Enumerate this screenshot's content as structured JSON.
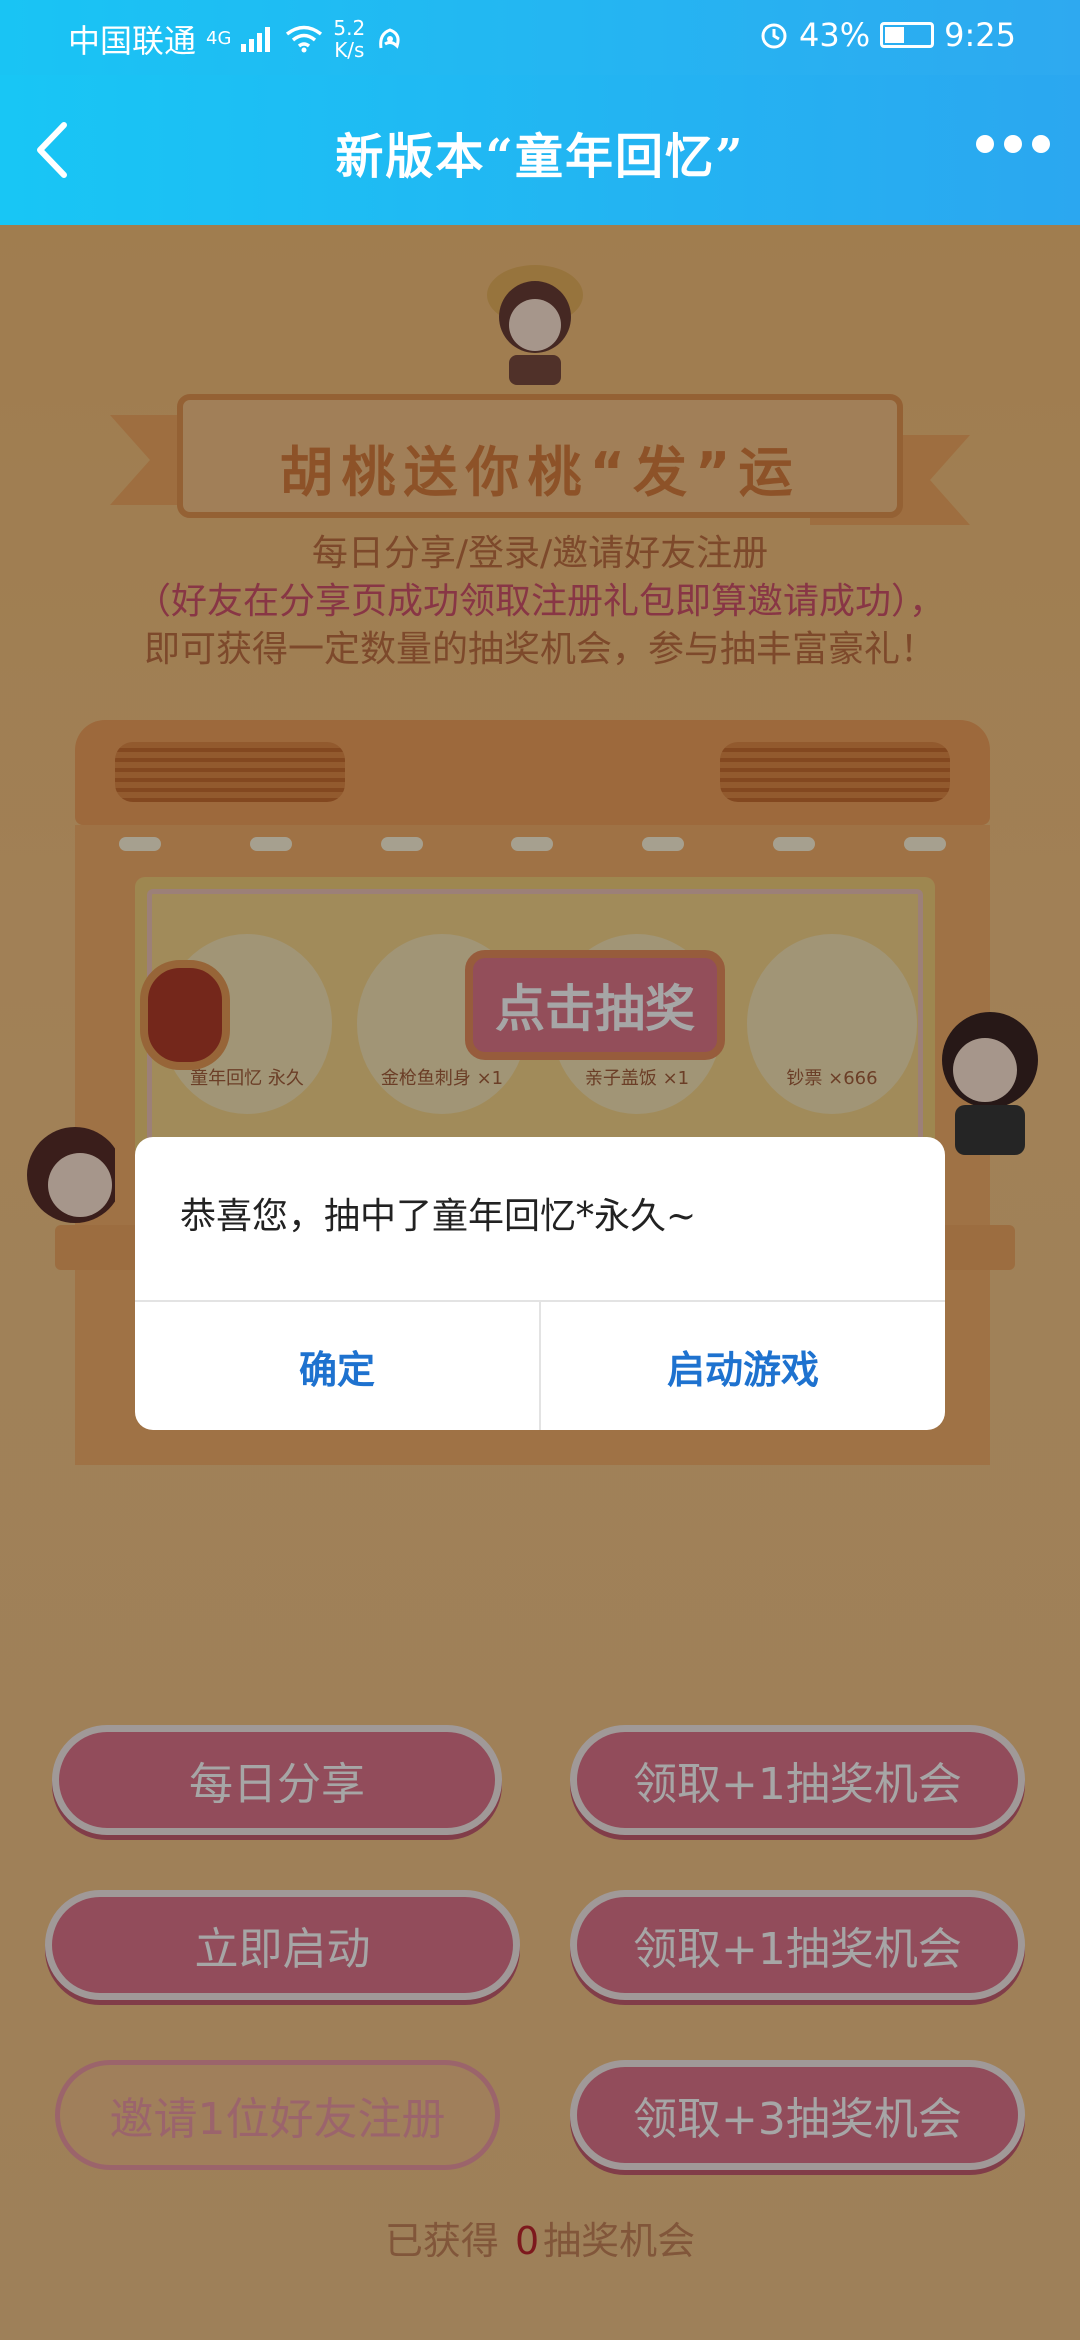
{
  "status_bar": {
    "carrier": "中国联通",
    "network": "4G",
    "speed_value": "5.2",
    "speed_unit": "K/s",
    "battery": "43%",
    "time": "9:25"
  },
  "nav": {
    "title": "新版本“童年回忆”"
  },
  "banner": {
    "title": "胡桃送你桃“发”运"
  },
  "description": {
    "line1": "每日分享/登录/邀请好友注册",
    "line2": "（好友在分享页成功领取注册礼包即算邀请成功），",
    "line3": "即可获得一定数量的抽奖机会，参与抽丰富豪礼！"
  },
  "prizes": [
    {
      "label": "童年回忆 永久"
    },
    {
      "label": "金枪鱼刺身 ×1"
    },
    {
      "label": "亲子盖饭 ×1"
    },
    {
      "label": "钞票 ×666"
    }
  ],
  "draw_button": "点击抽奖",
  "actions": [
    {
      "task": "每日分享",
      "reward": "领取+1抽奖机会"
    },
    {
      "task": "立即启动",
      "reward": "领取+1抽奖机会"
    },
    {
      "task": "邀请1位好友注册",
      "reward": "领取+3抽奖机会"
    }
  ],
  "earned": {
    "prefix": "已获得",
    "count": "0",
    "suffix": "抽奖机会"
  },
  "dialog": {
    "message": "恭喜您，抽中了童年回忆*永久~",
    "confirm": "确定",
    "launch": "启动游戏"
  }
}
